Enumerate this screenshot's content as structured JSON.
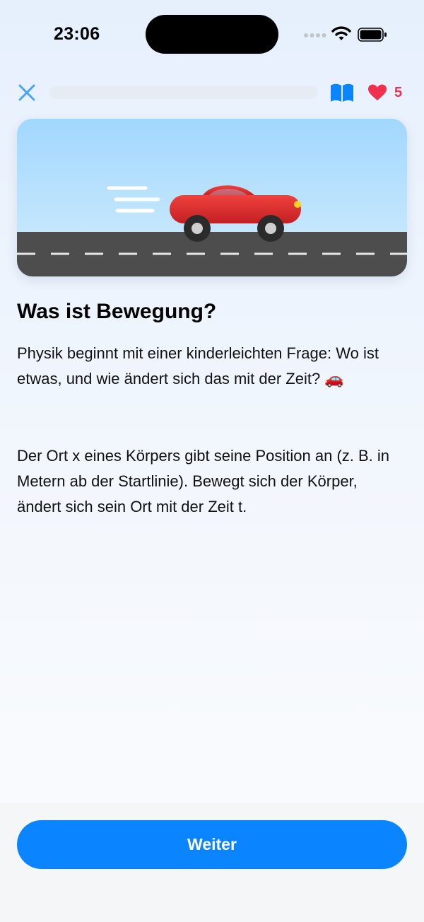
{
  "status_bar": {
    "time": "23:06"
  },
  "lesson": {
    "progress": 0.0,
    "lives": "5",
    "title": "Was ist Bewegung?",
    "paragraph_1": "Physik beginnt mit einer kinderleichten Frage: Wo ist etwas, und wie ändert sich das mit der Zeit? 🚗",
    "paragraph_2": "Der Ort x eines Körpers gibt seine Position an (z. B. in Metern ab der Startlinie). Bewegt sich der Körper, ändert sich sein Ort mit der Zeit t."
  },
  "footer": {
    "continue_label": "Weiter"
  },
  "colors": {
    "accent": "#0a84ff",
    "heart": "#f0304e",
    "car": "#e53935",
    "sky": "#bfe6fd",
    "road": "#4d4d4d"
  },
  "icons": [
    "signal-icon",
    "wifi-icon",
    "battery-icon",
    "close-icon",
    "book-icon",
    "heart-icon",
    "car-illustration"
  ]
}
